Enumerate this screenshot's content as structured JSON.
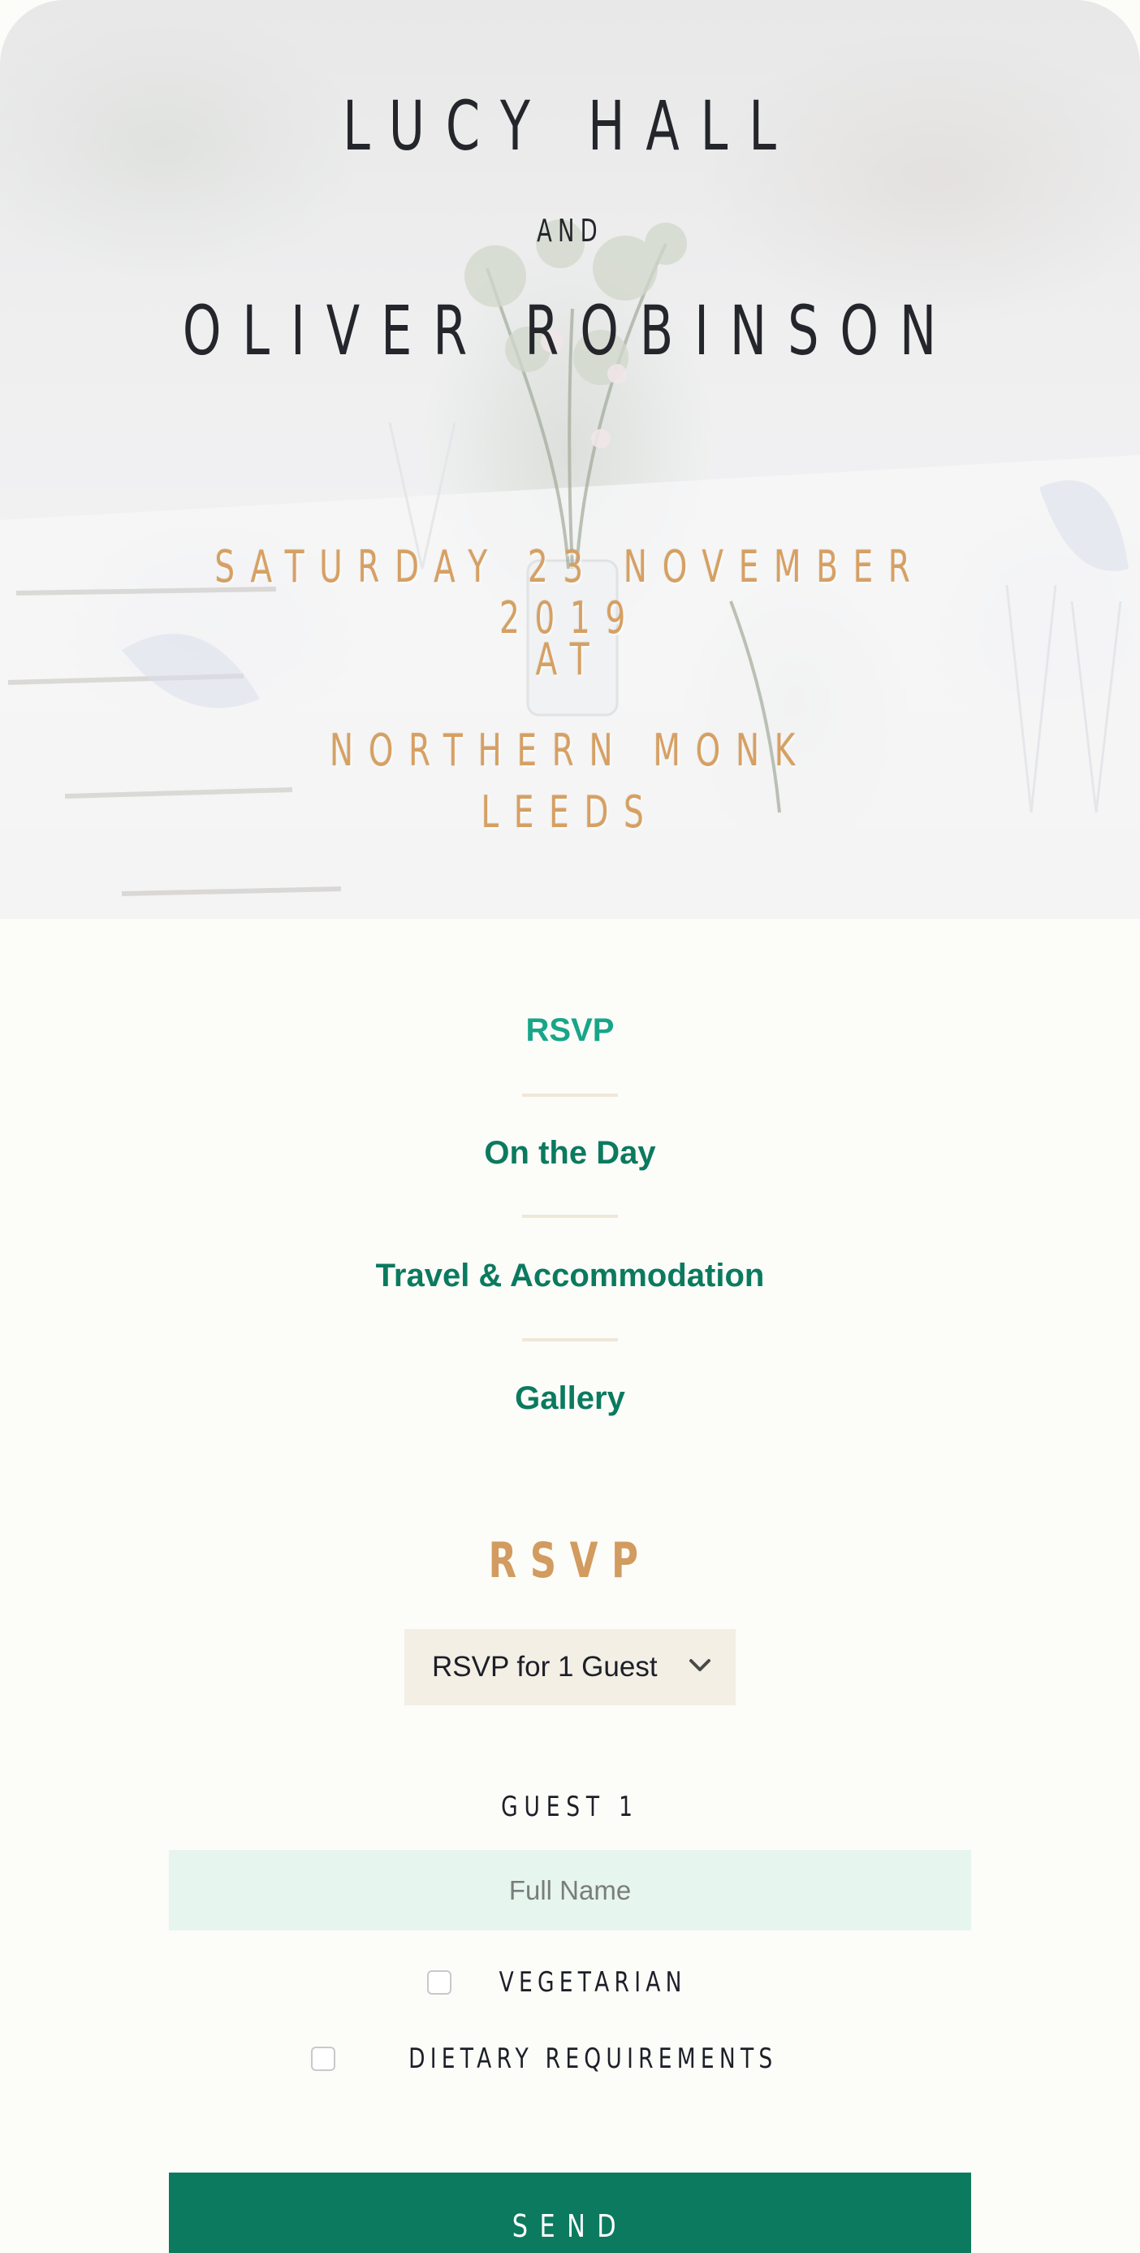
{
  "hero": {
    "name_one": "LUCY HALL",
    "conjunction": "AND",
    "name_two": "OLIVER ROBINSON",
    "date": "SATURDAY 23 NOVEMBER 2019",
    "at": "AT",
    "venue": "NORTHERN MONK",
    "city": "LEEDS"
  },
  "nav": {
    "items": [
      {
        "label": "RSVP",
        "active": true
      },
      {
        "label": "On the Day",
        "active": false
      },
      {
        "label": "Travel & Accommodation",
        "active": false
      },
      {
        "label": "Gallery",
        "active": false
      }
    ]
  },
  "rsvp": {
    "title": "RSVP",
    "guest_count_selected": "RSVP for 1 Guest",
    "guest_heading": "GUEST 1",
    "name_placeholder": "Full Name",
    "vegetarian_label": "VEGETARIAN",
    "dietary_label": "DIETARY REQUIREMENTS",
    "send_label": "SEND"
  },
  "colors": {
    "accent_green": "#0b7a5f",
    "active_green": "#18a58a",
    "gold": "#d29b5f",
    "input_bg": "#e7f5ef",
    "select_bg": "#f3efe5"
  }
}
